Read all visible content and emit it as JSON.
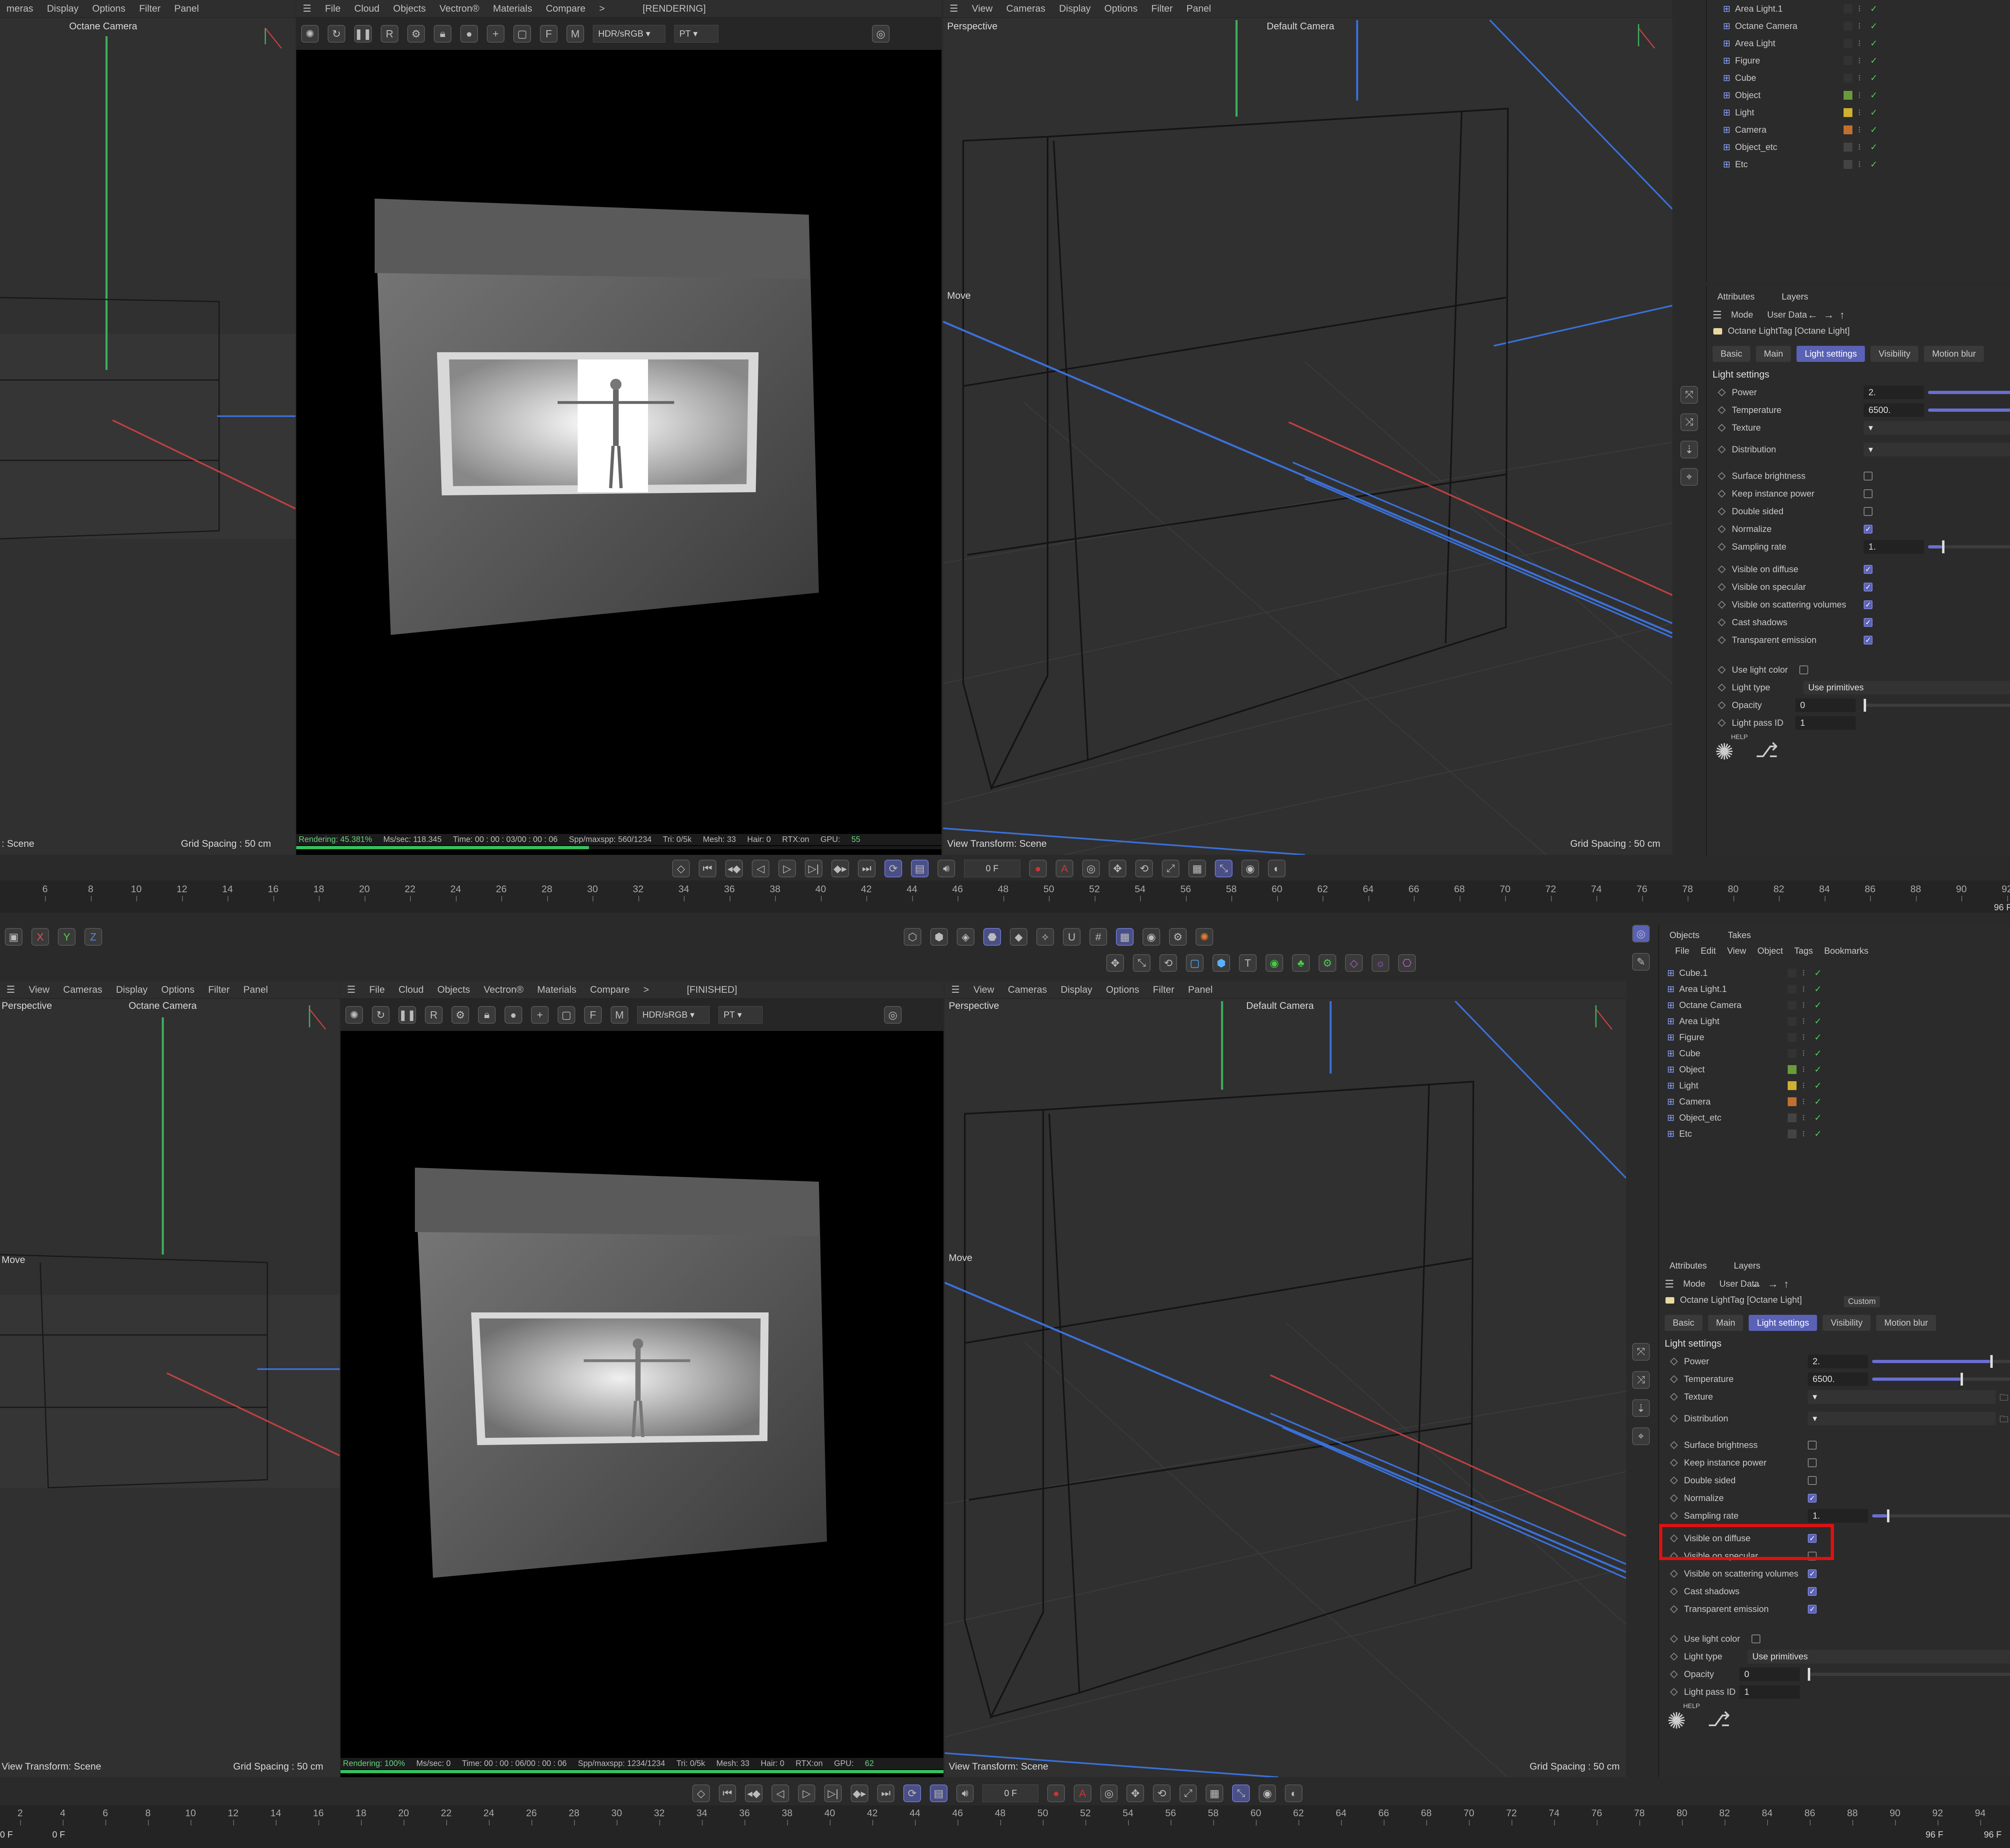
{
  "top": {
    "left_vp": {
      "menu": [
        "meras",
        "Display",
        "Options",
        "Filter",
        "Panel"
      ],
      "camera": "Octane Camera",
      "footer_left": ": Scene",
      "footer_right": "Grid Spacing : 50 cm"
    },
    "render_vp": {
      "menu": [
        "File",
        "Cloud",
        "Objects",
        "Vectron®",
        "Materials",
        "Compare",
        ">"
      ],
      "status_tag": "[RENDERING]",
      "color_space": "HDR/sRGB",
      "kernel": "PT",
      "status": {
        "rendering": "Rendering: 45.381%",
        "mssec": "Ms/sec: 118.345",
        "time": "Time: 00 : 00 : 03/00 : 00 : 06",
        "spp": "Spp/maxspp: 560/1234",
        "tri": "Tri: 0/5k",
        "mesh": "Mesh: 33",
        "hair": "Hair: 0",
        "rtx": "RTX:on",
        "gpu": "GPU:",
        "gpu_val": "55"
      },
      "progress": 0.45381
    },
    "persp_vp": {
      "menu": [
        "View",
        "Cameras",
        "Display",
        "Options",
        "Filter",
        "Panel"
      ],
      "label": "Perspective",
      "camera": "Default Camera",
      "move": "Move",
      "footer_left": "View Transform: Scene",
      "footer_right": "Grid Spacing : 50 cm"
    },
    "transport": {
      "frame": "0 F"
    },
    "ruler": {
      "ticks": [
        "6",
        "8",
        "10",
        "12",
        "14",
        "16",
        "18",
        "20",
        "22",
        "24",
        "26",
        "28",
        "30",
        "32",
        "34",
        "36",
        "38",
        "40",
        "42",
        "44",
        "46",
        "48",
        "50",
        "52",
        "54",
        "56",
        "58",
        "60",
        "62",
        "64",
        "66",
        "68",
        "70",
        "72",
        "74",
        "76",
        "78",
        "80",
        "82",
        "84",
        "86",
        "88",
        "90",
        "92"
      ],
      "end": "96 F"
    },
    "objects": [
      {
        "name": "Area Light.1",
        "color": "#333333"
      },
      {
        "name": "Octane Camera",
        "color": "#333333"
      },
      {
        "name": "Area Light",
        "color": "#333333"
      },
      {
        "name": "Figure",
        "color": "#333333"
      },
      {
        "name": "Cube",
        "color": "#333333"
      },
      {
        "name": "Object",
        "color": "#6a9a3a"
      },
      {
        "name": "Light",
        "color": "#d0b030"
      },
      {
        "name": "Camera",
        "color": "#c07030"
      },
      {
        "name": "Object_etc",
        "color": "#444444"
      },
      {
        "name": "Etc",
        "color": "#444444"
      }
    ],
    "attr": {
      "tabs": [
        "Attributes",
        "Layers"
      ],
      "mode": "Mode",
      "user_data": "User Data",
      "tag": "Octane LightTag [Octane Light]",
      "ptabs": [
        "Basic",
        "Main",
        "Light settings",
        "Visibility",
        "Motion blur"
      ],
      "section": "Light settings",
      "power_label": "Power",
      "power": "2.",
      "temp_label": "Temperature",
      "temp": "6500.",
      "texture": "Texture",
      "distribution": "Distribution",
      "surface_brightness": "Surface brightness",
      "keep_instance_power": "Keep instance power",
      "double_sided": "Double sided",
      "normalize": "Normalize",
      "sampling_label": "Sampling rate",
      "sampling": "1.",
      "visible_diffuse": "Visible on diffuse",
      "visible_specular": "Visible on specular",
      "visible_scattering": "Visible on scattering volumes",
      "cast_shadows": "Cast shadows",
      "transparent_emission": "Transparent emission",
      "use_light_color": "Use light color",
      "light_type_label": "Light type",
      "light_type": "Use primitives",
      "opacity_label": "Opacity",
      "opacity": "0",
      "pass_label": "Light pass ID",
      "pass": "1",
      "help": "HELP"
    }
  },
  "bottom": {
    "toolbar_axes": [
      "X",
      "Y",
      "Z"
    ],
    "left_vp": {
      "menu": [
        "View",
        "Cameras",
        "Display",
        "Options",
        "Filter",
        "Panel"
      ],
      "label": "Perspective",
      "camera": "Octane Camera",
      "move": "Move",
      "footer_left": "View Transform: Scene",
      "footer_right": "Grid Spacing : 50 cm"
    },
    "render_vp": {
      "menu": [
        "File",
        "Cloud",
        "Objects",
        "Vectron®",
        "Materials",
        "Compare",
        ">"
      ],
      "status_tag": "[FINISHED]",
      "color_space": "HDR/sRGB",
      "kernel": "PT",
      "status": {
        "rendering": "Rendering: 100%",
        "mssec": "Ms/sec: 0",
        "time": "Time: 00 : 00 : 06/00 : 00 : 06",
        "spp": "Spp/maxspp: 1234/1234",
        "tri": "Tri: 0/5k",
        "mesh": "Mesh: 33",
        "hair": "Hair: 0",
        "rtx": "RTX:on",
        "gpu": "GPU:",
        "gpu_val": "62"
      },
      "progress": 1.0
    },
    "persp_vp": {
      "menu": [
        "View",
        "Cameras",
        "Display",
        "Options",
        "Filter",
        "Panel"
      ],
      "label": "Perspective",
      "camera": "Default Camera",
      "move": "Move",
      "footer_left": "View Transform: Scene",
      "footer_right": "Grid Spacing : 50 cm"
    },
    "transport": {
      "frame": "0 F"
    },
    "ruler": {
      "ticks": [
        "2",
        "4",
        "6",
        "8",
        "10",
        "12",
        "14",
        "16",
        "18",
        "20",
        "22",
        "24",
        "26",
        "28",
        "30",
        "32",
        "34",
        "36",
        "38",
        "40",
        "42",
        "44",
        "46",
        "48",
        "50",
        "52",
        "54",
        "56",
        "58",
        "60",
        "62",
        "64",
        "66",
        "68",
        "70",
        "72",
        "74",
        "76",
        "78",
        "80",
        "82",
        "84",
        "86",
        "88",
        "90",
        "92",
        "94"
      ],
      "start": "0 F",
      "start2": "0 F",
      "end": "96 F",
      "end2": "96 F"
    },
    "obj_tabs": [
      "Objects",
      "Takes"
    ],
    "obj_menu": [
      "File",
      "Edit",
      "View",
      "Object",
      "Tags",
      "Bookmarks"
    ],
    "objects": [
      {
        "name": "Cube.1",
        "color": "#333333"
      },
      {
        "name": "Area Light.1",
        "color": "#333333"
      },
      {
        "name": "Octane Camera",
        "color": "#333333"
      },
      {
        "name": "Area Light",
        "color": "#333333"
      },
      {
        "name": "Figure",
        "color": "#333333"
      },
      {
        "name": "Cube",
        "color": "#333333"
      },
      {
        "name": "Object",
        "color": "#6a9a3a"
      },
      {
        "name": "Light",
        "color": "#d0b030"
      },
      {
        "name": "Camera",
        "color": "#c07030"
      },
      {
        "name": "Object_etc",
        "color": "#444444"
      },
      {
        "name": "Etc",
        "color": "#444444"
      }
    ],
    "attr": {
      "tabs": [
        "Attributes",
        "Layers"
      ],
      "mode": "Mode",
      "user_data": "User Data",
      "custom": "Custom",
      "tag": "Octane LightTag [Octane Light]",
      "ptabs": [
        "Basic",
        "Main",
        "Light settings",
        "Visibility",
        "Motion blur"
      ],
      "section": "Light settings",
      "power_label": "Power",
      "power": "2.",
      "temp_label": "Temperature",
      "temp": "6500.",
      "texture": "Texture",
      "distribution": "Distribution",
      "surface_brightness": "Surface brightness",
      "keep_instance_power": "Keep instance power",
      "double_sided": "Double sided",
      "normalize": "Normalize",
      "sampling_label": "Sampling rate",
      "sampling": "1.",
      "visible_diffuse": "Visible on diffuse",
      "visible_specular": "Visible on specular",
      "visible_scattering": "Visible on scattering volumes",
      "cast_shadows": "Cast shadows",
      "transparent_emission": "Transparent emission",
      "use_light_color": "Use light color",
      "light_type_label": "Light type",
      "light_type": "Use primitives",
      "opacity_label": "Opacity",
      "opacity": "0",
      "pass_label": "Light pass ID",
      "pass": "1",
      "help": "HELP"
    }
  },
  "colors": {
    "accent": "#5a62b6",
    "highlight": "#e01010",
    "x_axis": "#c04040",
    "y_axis": "#40b060",
    "z_axis": "#3a70d8",
    "progress": "#36c060"
  }
}
